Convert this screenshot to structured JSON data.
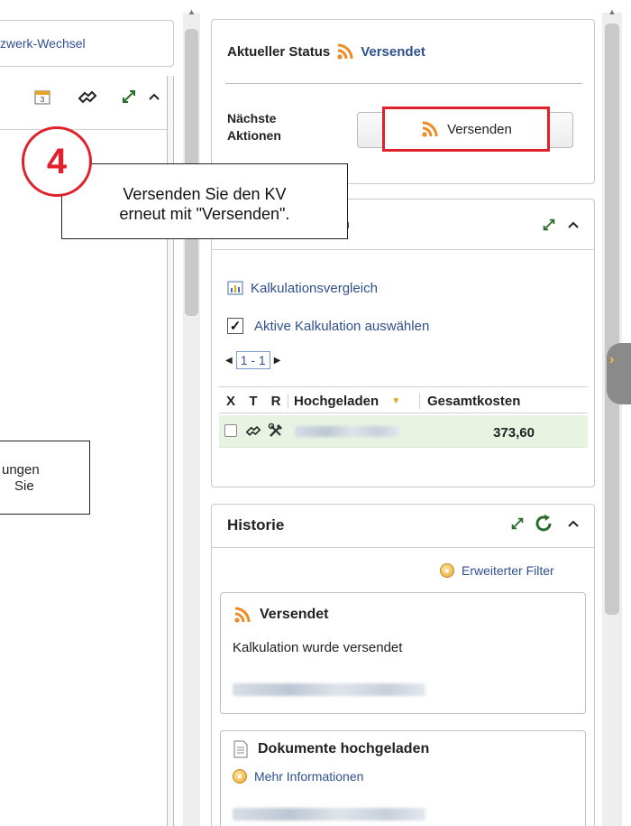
{
  "left_panel": {
    "tab_text": "zwerk-Wechsel"
  },
  "status": {
    "label": "Aktueller Status",
    "value": "Versendet",
    "next_actions_line1": "Nächste",
    "next_actions_line2": "Aktionen",
    "button_label": "Versenden"
  },
  "callout": {
    "step_number": "4",
    "line1": "Versenden Sie den KV",
    "line2": "erneut mit \"Versenden\".",
    "partial_line1": "ungen",
    "partial_line2": "Sie"
  },
  "calculation": {
    "title_partial": "n",
    "compare_link": "Kalkulationsvergleich",
    "active_checkbox_label": "Aktive Kalkulation auswählen",
    "pager": "1 - 1",
    "columns": [
      "X",
      "T",
      "R",
      "Hochgeladen",
      "Gesamtkosten"
    ],
    "rows": [
      {
        "total": "373,60"
      }
    ]
  },
  "history": {
    "title": "Historie",
    "filter_link": "Erweiterter Filter",
    "entries": [
      {
        "title": "Versendet",
        "text": "Kalkulation wurde versendet"
      },
      {
        "title": "Dokumente hochgeladen",
        "link": "Mehr Informationen"
      }
    ]
  },
  "colors": {
    "highlight": "#e0212b",
    "link": "#2f4f8f",
    "rss": "#f08a24"
  }
}
